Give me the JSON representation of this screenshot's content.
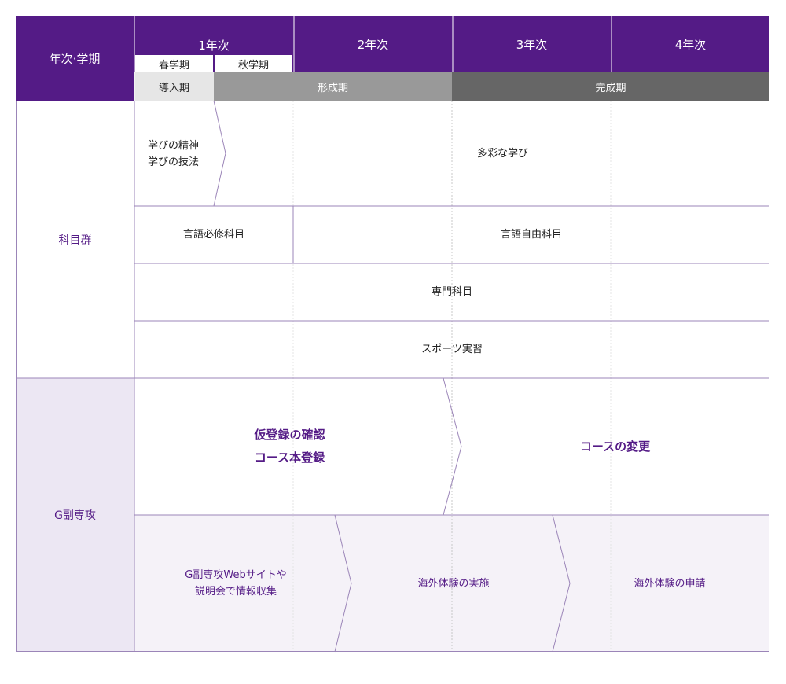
{
  "colors": {
    "header": "#541b86",
    "phase_intro": "#e6e6e6",
    "phase_formation": "#999999",
    "phase_completion": "#666666",
    "border": "#9b85b8",
    "gminor_label_bg": "#ece7f3",
    "gminor_row_bg": "#f5f2f8"
  },
  "header": {
    "row_label": "年次·学期",
    "years": [
      "1年次",
      "2年次",
      "3年次",
      "4年次"
    ],
    "semesters": [
      "春学期",
      "秋学期"
    ],
    "phases": [
      "導入期",
      "形成期",
      "完成期"
    ]
  },
  "subjects": {
    "label": "科目群",
    "row1": {
      "first_lines": [
        "学びの精神",
        "学びの技法"
      ],
      "second": "多彩な学び"
    },
    "row2": {
      "first": "言語必修科目",
      "second": "言語自由科目"
    },
    "row3": "専門科目",
    "row4": "スポーツ実習"
  },
  "gminor": {
    "label": "G副専攻",
    "row1": {
      "first_lines": [
        "仮登録の確認",
        "コース本登録"
      ],
      "second": "コースの変更"
    },
    "row2": {
      "first_lines": [
        "G副専攻Webサイトや",
        "説明会で情報収集"
      ],
      "second": "海外体験の実施",
      "third": "海外体験の申請"
    }
  }
}
